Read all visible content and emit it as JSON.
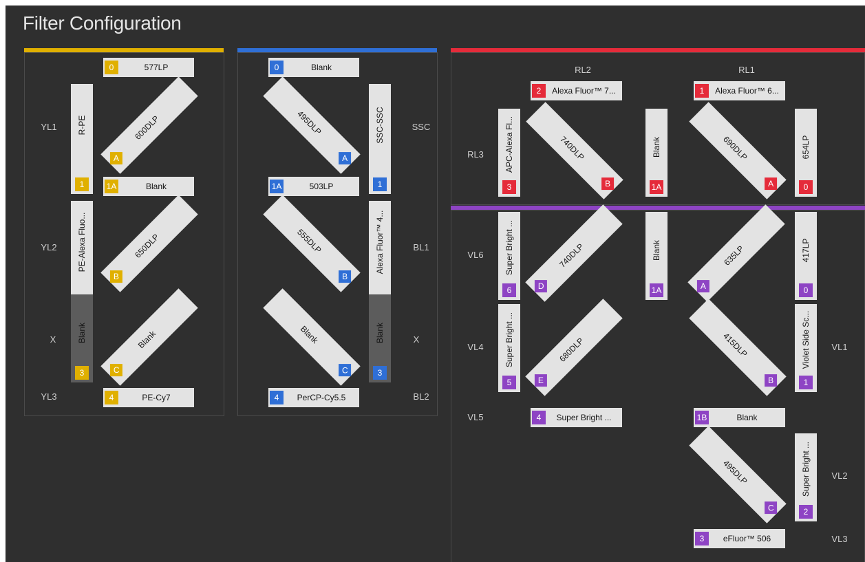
{
  "title": "Filter Configuration",
  "colors": {
    "yellow": "#e0b000",
    "blue": "#2f6fd6",
    "red": "#e52b3a",
    "purple": "#8e44c4",
    "background": "#2f2f2f",
    "filter": "#e3e3e3"
  },
  "yellow_laser": {
    "labels": {
      "yl1": "YL1",
      "yl2": "YL2",
      "x": "X",
      "yl3": "YL3"
    },
    "filters": {
      "f0": {
        "badge": "0",
        "text": "577LP"
      },
      "f1": {
        "badge": "1",
        "text": "R-PE"
      },
      "f1a": {
        "badge": "1A",
        "text": "Blank"
      },
      "f2": {
        "badge": "2",
        "text": "PE-Alexa Fluo..."
      },
      "f3": {
        "badge": "3",
        "text": "Blank"
      },
      "f4": {
        "badge": "4",
        "text": "PE-Cy7"
      }
    },
    "dichroics": {
      "a": {
        "mark": "A",
        "text": "600DLP"
      },
      "b": {
        "mark": "B",
        "text": "650DLP"
      },
      "c": {
        "mark": "C",
        "text": "Blank"
      }
    }
  },
  "blue_laser": {
    "labels": {
      "ssc": "SSC",
      "bl1": "BL1",
      "x": "X",
      "bl2": "BL2"
    },
    "filters": {
      "f0": {
        "badge": "0",
        "text": "Blank"
      },
      "f1": {
        "badge": "1",
        "text": "SSC-SSC"
      },
      "f1a": {
        "badge": "1A",
        "text": "503LP"
      },
      "f2": {
        "badge": "2",
        "text": "Alexa Fluor™ 4..."
      },
      "f3": {
        "badge": "3",
        "text": "Blank"
      },
      "f4": {
        "badge": "4",
        "text": "PerCP-Cy5.5"
      }
    },
    "dichroics": {
      "a": {
        "mark": "A",
        "text": "495DLP"
      },
      "b": {
        "mark": "B",
        "text": "555DLP"
      },
      "c": {
        "mark": "C",
        "text": "Blank"
      }
    }
  },
  "red_laser": {
    "labels": {
      "rl2": "RL2",
      "rl1": "RL1",
      "rl3": "RL3"
    },
    "filters": {
      "f2": {
        "badge": "2",
        "text": "Alexa Fluor™ 7..."
      },
      "f1": {
        "badge": "1",
        "text": "Alexa Fluor™ 6..."
      },
      "f3": {
        "badge": "3",
        "text": "APC-Alexa Fl..."
      },
      "f1a": {
        "badge": "1A",
        "text": "Blank"
      },
      "f0": {
        "badge": "0",
        "text": "654LP"
      }
    },
    "dichroics": {
      "b": {
        "mark": "B",
        "text": "740DLP"
      },
      "a": {
        "mark": "A",
        "text": "690DLP"
      }
    }
  },
  "violet_laser": {
    "labels": {
      "vl6": "VL6",
      "vl4": "VL4",
      "vl5": "VL5",
      "vl1": "VL1",
      "vl2": "VL2",
      "vl3": "VL3"
    },
    "filters": {
      "f6": {
        "badge": "6",
        "text": "Super Bright ..."
      },
      "f1a": {
        "badge": "1A",
        "text": "Blank"
      },
      "f0": {
        "badge": "0",
        "text": "417LP"
      },
      "f5": {
        "badge": "5",
        "text": "Super Bright ..."
      },
      "f1": {
        "badge": "1",
        "text": "Violet Side Sc..."
      },
      "f4": {
        "badge": "4",
        "text": "Super Bright ..."
      },
      "f1b": {
        "badge": "1B",
        "text": "Blank"
      },
      "f2": {
        "badge": "2",
        "text": "Super Bright ..."
      },
      "f3": {
        "badge": "3",
        "text": "eFluor™ 506"
      }
    },
    "dichroics": {
      "d": {
        "mark": "D",
        "text": "740DLP"
      },
      "a": {
        "mark": "A",
        "text": "635LP"
      },
      "e": {
        "mark": "E",
        "text": "680DLP"
      },
      "b": {
        "mark": "B",
        "text": "415DLP"
      },
      "c": {
        "mark": "C",
        "text": "495DLP"
      }
    }
  }
}
